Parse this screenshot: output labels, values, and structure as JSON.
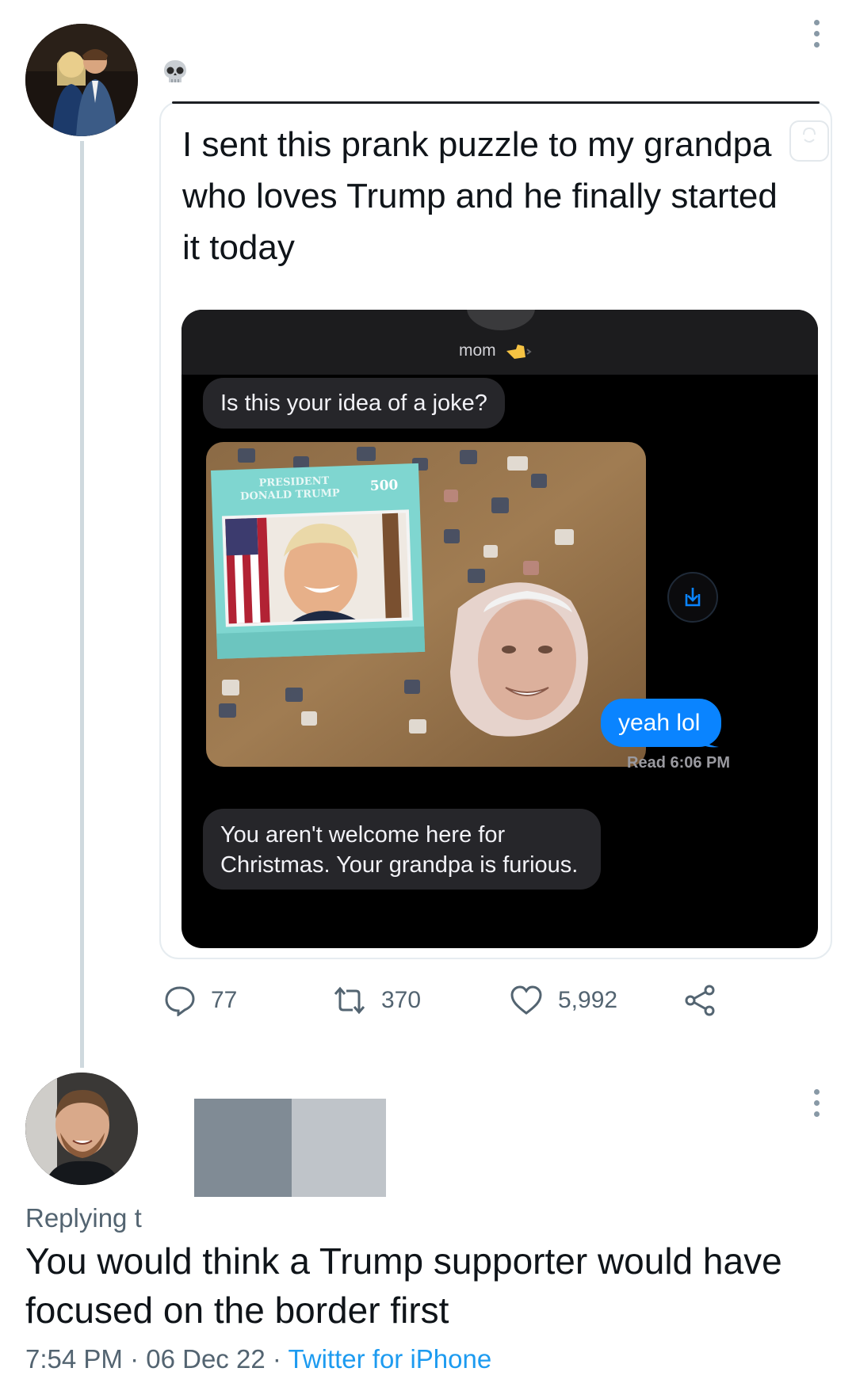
{
  "tweet": {
    "emoji": "💀",
    "quoted": {
      "text": "I sent this prank puzzle to my grandpa who loves Trump and he finally started it today",
      "conversation": {
        "contact": "mom",
        "messages": [
          {
            "from": "them",
            "text": "Is this your idea of a joke?"
          },
          {
            "from": "me",
            "text": "yeah lol"
          },
          {
            "from": "them",
            "text": "You aren't welcome here for Christmas. Your grandpa is furious."
          }
        ],
        "read_receipt": "Read 6:06 PM",
        "puzzle_box": {
          "line1": "PRESIDENT",
          "line2": "DONALD TRUMP",
          "pieces": "500"
        }
      }
    },
    "actions": {
      "replies": "77",
      "retweets": "370",
      "likes": "5,992"
    }
  },
  "reply": {
    "replying_to": "Replying t",
    "text": "You would think a Trump supporter would have focused on the border first",
    "time": "7:54 PM",
    "date": "06 Dec 22",
    "source": "Twitter for iPhone",
    "separator": "·"
  },
  "colors": {
    "link": "#1d9bf0",
    "imessage_blue": "#0a84ff",
    "secondary_text": "#536471",
    "thread_line": "#cfd9de"
  },
  "icons": [
    "more-icon",
    "skull-emoji",
    "reply-icon",
    "retweet-icon",
    "like-icon",
    "share-icon",
    "download-icon",
    "shopping-bag-icon"
  ]
}
